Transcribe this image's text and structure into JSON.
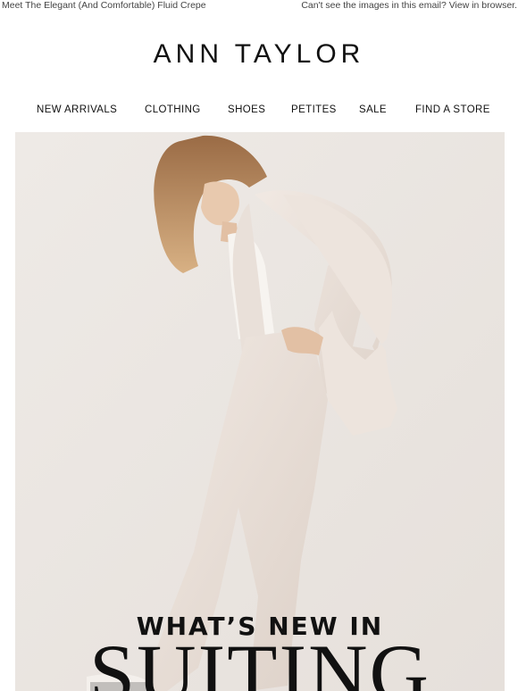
{
  "preheader": {
    "text": "Meet The Elegant (And Comfortable) Fluid Crepe",
    "view_link": "Can't see the images in this email? View in browser."
  },
  "brand": {
    "logo_text": "ANN TAYLOR"
  },
  "nav": [
    {
      "label": "NEW ARRIVALS"
    },
    {
      "label": "CLOTHING"
    },
    {
      "label": "SHOES"
    },
    {
      "label": "PETITES"
    },
    {
      "label": "SALE"
    },
    {
      "label": "FIND A STORE"
    }
  ],
  "hero": {
    "headline_top": "WHAT’S NEW IN",
    "headline_main": "SUITING"
  }
}
